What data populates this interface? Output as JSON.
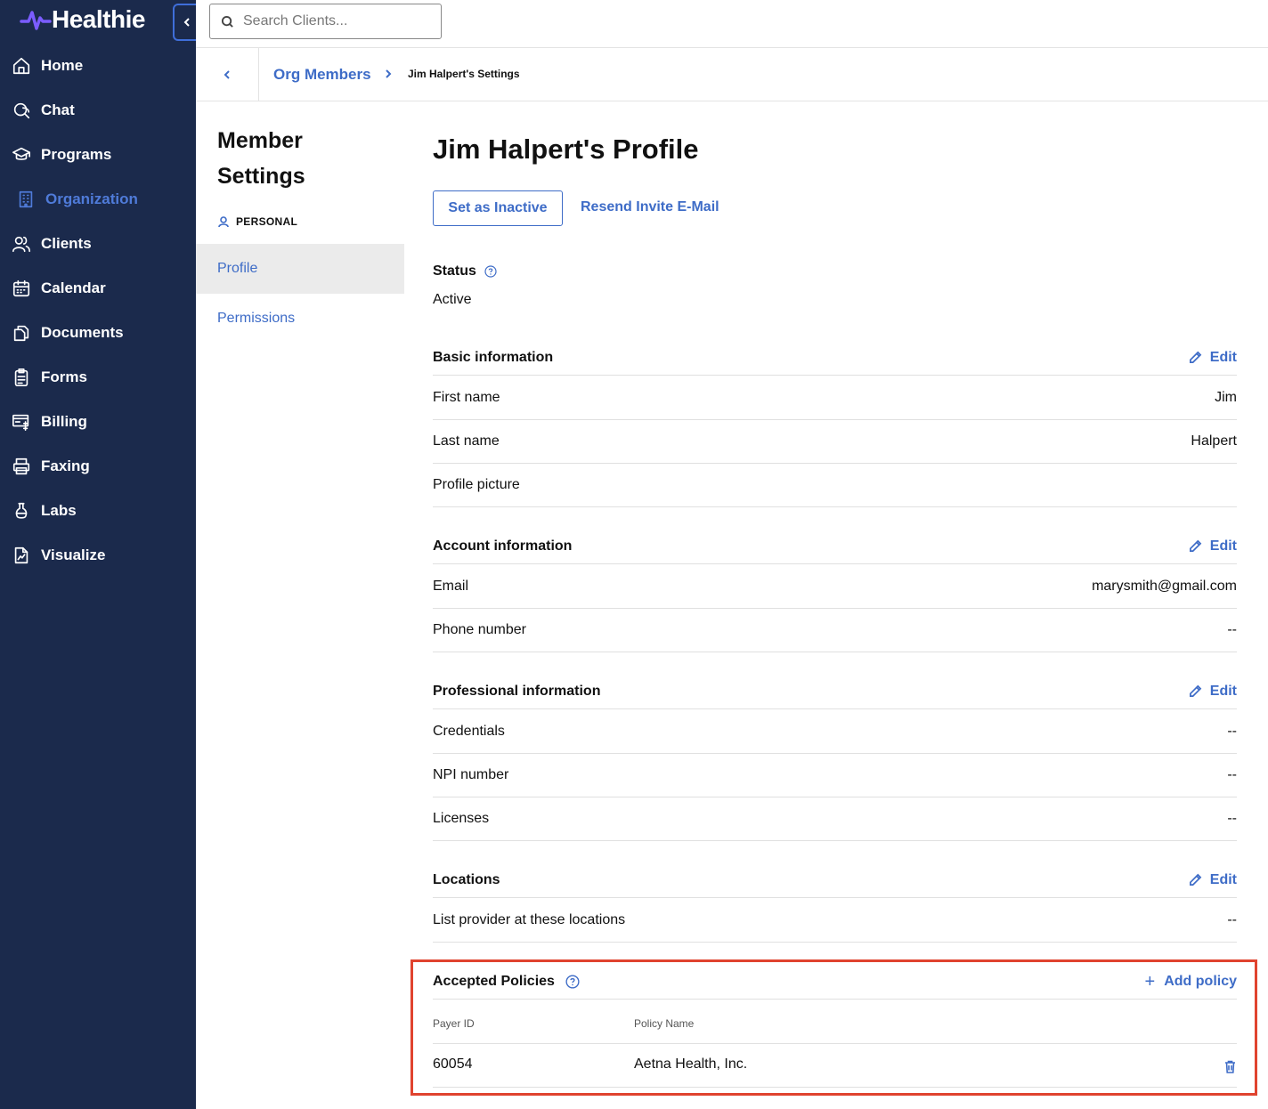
{
  "app": {
    "brand": "Healthie",
    "accent_color": "#3e6cc7",
    "sidebar_color": "#1b2a4c"
  },
  "sidebar": {
    "items": [
      {
        "label": "Home",
        "icon": "home-icon"
      },
      {
        "label": "Chat",
        "icon": "chat-icon"
      },
      {
        "label": "Programs",
        "icon": "graduation-cap-icon"
      },
      {
        "label": "Organization",
        "icon": "building-icon",
        "active": true
      },
      {
        "label": "Clients",
        "icon": "users-icon"
      },
      {
        "label": "Calendar",
        "icon": "calendar-icon"
      },
      {
        "label": "Documents",
        "icon": "documents-icon"
      },
      {
        "label": "Forms",
        "icon": "clipboard-icon"
      },
      {
        "label": "Billing",
        "icon": "billing-icon"
      },
      {
        "label": "Faxing",
        "icon": "printer-icon"
      },
      {
        "label": "Labs",
        "icon": "flask-icon"
      },
      {
        "label": "Visualize",
        "icon": "chart-file-icon"
      }
    ]
  },
  "search": {
    "placeholder": "Search Clients..."
  },
  "breadcrumb": {
    "parent": "Org Members",
    "current": "Jim Halpert's Settings"
  },
  "subnav": {
    "title": "Member Settings",
    "section": "PERSONAL",
    "items": [
      "Profile",
      "Permissions"
    ],
    "selected": "Profile"
  },
  "profile": {
    "title": "Jim Halpert's Profile",
    "set_inactive_label": "Set as Inactive",
    "resend_invite_label": "Resend Invite E-Mail",
    "status_label": "Status",
    "status_value": "Active",
    "edit_label": "Edit",
    "basic": {
      "title": "Basic information",
      "rows": [
        {
          "label": "First name",
          "value": "Jim"
        },
        {
          "label": "Last name",
          "value": "Halpert"
        },
        {
          "label": "Profile picture",
          "value": ""
        }
      ]
    },
    "account": {
      "title": "Account information",
      "rows": [
        {
          "label": "Email",
          "value": "marysmith@gmail.com"
        },
        {
          "label": "Phone number",
          "value": "--"
        }
      ]
    },
    "professional": {
      "title": "Professional information",
      "rows": [
        {
          "label": "Credentials",
          "value": "--"
        },
        {
          "label": "NPI number",
          "value": "--"
        },
        {
          "label": "Licenses",
          "value": "--"
        }
      ]
    },
    "locations": {
      "title": "Locations",
      "rows": [
        {
          "label": "List provider at these locations",
          "value": "--"
        }
      ]
    },
    "policies": {
      "title": "Accepted Policies",
      "add_label": "Add policy",
      "columns": [
        "Payer ID",
        "Policy Name"
      ],
      "rows": [
        {
          "payer_id": "60054",
          "policy_name": "Aetna Health, Inc."
        }
      ],
      "highlight_color": "#e0432f"
    }
  }
}
